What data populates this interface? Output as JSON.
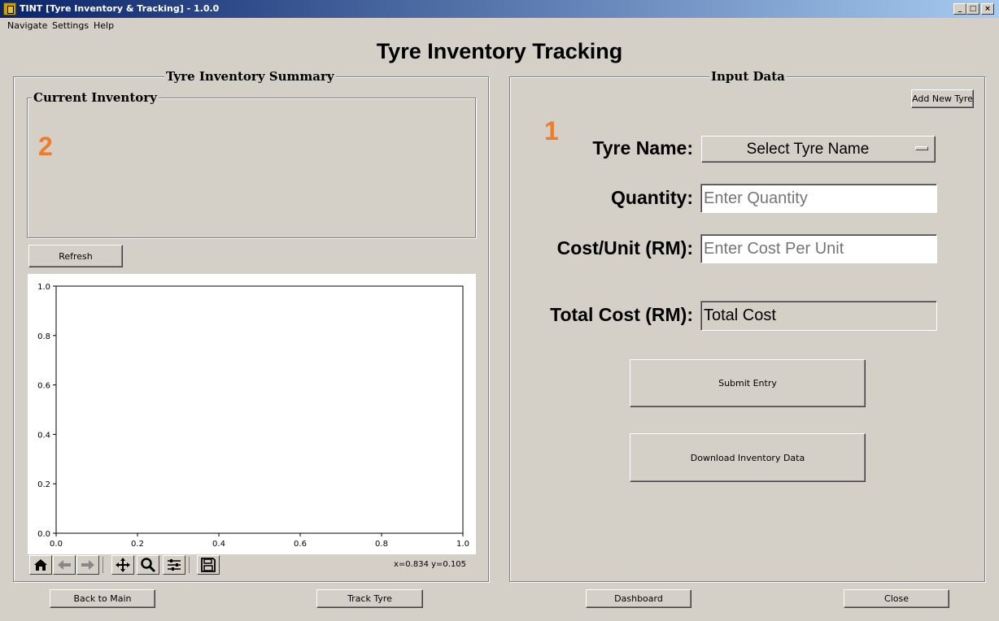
{
  "window": {
    "title": "TINT [Tyre Inventory & Tracking] - 1.0.0"
  },
  "menu": [
    "Navigate",
    "Settings",
    "Help"
  ],
  "page_title": "Tyre Inventory Tracking",
  "left_panel": {
    "title": "Tyre Inventory Summary",
    "current_inventory": {
      "title": "Current Inventory",
      "marker": "2"
    },
    "refresh_label": "Refresh",
    "chart_coord": "x=0.834 y=0.105"
  },
  "right_panel": {
    "title": "Input Data",
    "add_new_label": "Add New Tyre",
    "marker": "1",
    "tyre_name_label": "Tyre Name:",
    "tyre_name_selected": "Select Tyre Name",
    "quantity_label": "Quantity:",
    "quantity_placeholder": "Enter Quantity",
    "cost_label": "Cost/Unit (RM):",
    "cost_placeholder": "Enter Cost Per Unit",
    "total_label": "Total Cost (RM):",
    "total_value": "Total Cost",
    "submit_label": "Submit Entry",
    "download_label": "Download Inventory Data"
  },
  "footer": {
    "back_label": "Back to Main",
    "track_label": "Track Tyre",
    "dashboard_label": "Dashboard",
    "close_label": "Close"
  },
  "toolbar_icons": [
    "home-icon",
    "back-arrow-icon",
    "forward-arrow-icon",
    "pan-icon",
    "zoom-icon",
    "configure-subplots-icon",
    "save-icon"
  ],
  "chart_data": {
    "type": "line",
    "series": [],
    "xlim": [
      0.0,
      1.0
    ],
    "ylim": [
      0.0,
      1.0
    ],
    "xticks": [
      "0.0",
      "0.2",
      "0.4",
      "0.6",
      "0.8",
      "1.0"
    ],
    "yticks": [
      "0.0",
      "0.2",
      "0.4",
      "0.6",
      "0.8",
      "1.0"
    ],
    "grid": false
  },
  "colors": {
    "marker_orange": "#f07c2a",
    "window_bg": "#d4d0c8",
    "titlebar": "#0a246a"
  }
}
